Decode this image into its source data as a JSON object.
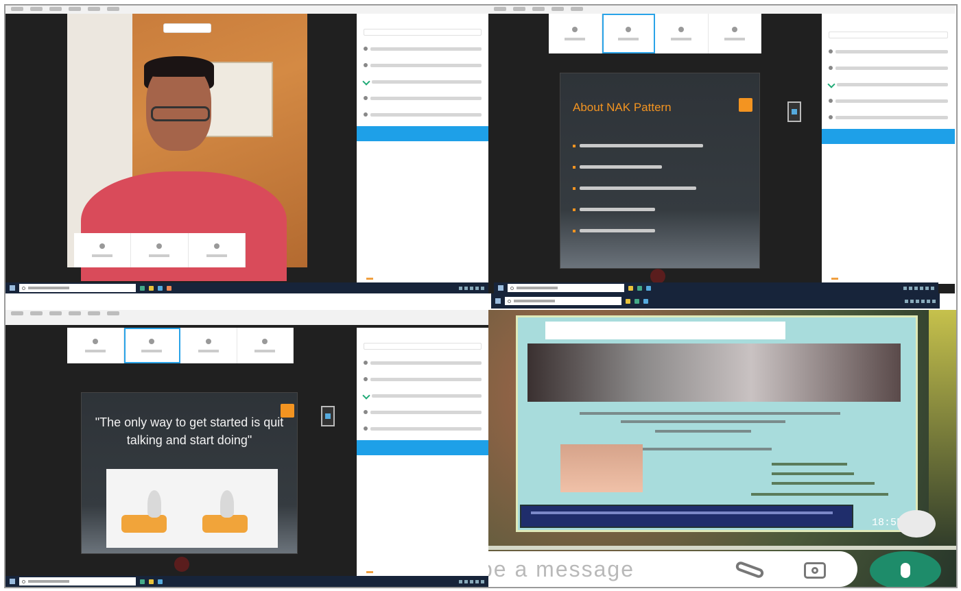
{
  "q2": {
    "slide_title": "About NAK Pattern"
  },
  "q3": {
    "slide_quote": "\"The only way to get started is quit talking and start doing\""
  },
  "q4": {
    "time": "18:55",
    "message_placeholder": "pe a message"
  },
  "colors": {
    "accent_orange": "#f39421",
    "join_button_blue": "#1ea0e8",
    "taskbar_navy": "#17243a",
    "whatsapp_green": "#1e8c6a"
  },
  "icons": [
    "video-icon",
    "search-icon",
    "attach-icon",
    "camera-icon",
    "mic-icon",
    "checkmark-icon",
    "windows-start-icon"
  ]
}
